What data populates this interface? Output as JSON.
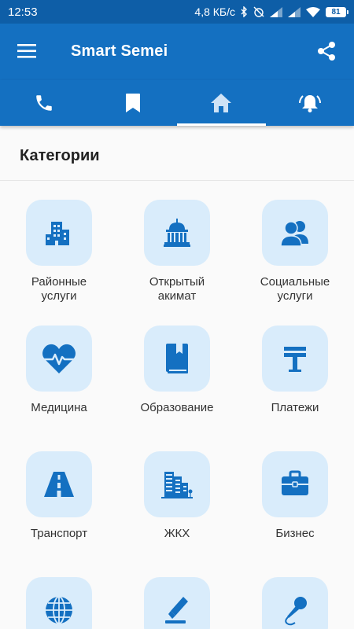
{
  "status_bar": {
    "time": "12:53",
    "network_speed": "4,8 КБ/с",
    "battery": "81"
  },
  "app_bar": {
    "title": "Smart Semei",
    "menu_icon": "hamburger-menu-icon",
    "share_icon": "share-icon"
  },
  "tabs": [
    {
      "icon": "phone-icon",
      "active": false
    },
    {
      "icon": "bookmark-icon",
      "active": false
    },
    {
      "icon": "home-icon",
      "active": true
    },
    {
      "icon": "alarm-bell-icon",
      "active": false
    }
  ],
  "colors": {
    "status_bar": "#0e5ea7",
    "primary": "#1470c1",
    "tile_background": "#d9ecfb",
    "icon": "#1470c1"
  },
  "section": {
    "title": "Категории"
  },
  "categories": [
    {
      "label": "Районные\nуслуги",
      "icon": "building-icon"
    },
    {
      "label": "Открытый\nакимат",
      "icon": "government-building-icon"
    },
    {
      "label": "Социальные\nуслуги",
      "icon": "people-icon"
    },
    {
      "label": "Медицина",
      "icon": "heart-pulse-icon"
    },
    {
      "label": "Образование",
      "icon": "book-icon"
    },
    {
      "label": "Платежи",
      "icon": "tenge-icon"
    },
    {
      "label": "Транспорт",
      "icon": "road-icon"
    },
    {
      "label": "ЖКХ",
      "icon": "city-buildings-icon"
    },
    {
      "label": "Бизнес",
      "icon": "briefcase-icon"
    },
    {
      "label": "",
      "icon": "globe-icon"
    },
    {
      "label": "",
      "icon": "pen-icon"
    },
    {
      "label": "",
      "icon": "microphone-icon"
    }
  ]
}
